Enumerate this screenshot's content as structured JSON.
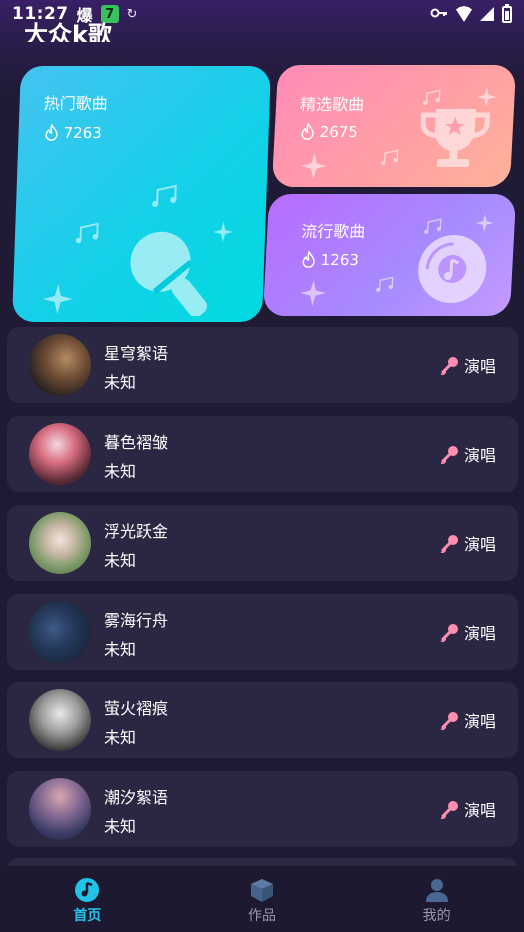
{
  "status_bar": {
    "time": "11:27",
    "app_icon": "爆",
    "badge": "7",
    "sync": "↻"
  },
  "app": {
    "title": "大众k歌"
  },
  "categories": [
    {
      "title": "热门歌曲",
      "count": "7263",
      "icon": "microphone-icon",
      "color": "#1fcde6"
    },
    {
      "title": "精选歌曲",
      "count": "2675",
      "icon": "trophy-icon",
      "color": "#ff9aaa"
    },
    {
      "title": "流行歌曲",
      "count": "1263",
      "icon": "disc-icon",
      "color": "#b07bff"
    }
  ],
  "songs": [
    {
      "name": "星穹絮语",
      "artist": "未知",
      "action": "演唱"
    },
    {
      "name": "暮色褶皱",
      "artist": "未知",
      "action": "演唱"
    },
    {
      "name": "浮光跃金",
      "artist": "未知",
      "action": "演唱"
    },
    {
      "name": "雾海行舟",
      "artist": "未知",
      "action": "演唱"
    },
    {
      "name": "萤火褶痕",
      "artist": "未知",
      "action": "演唱"
    },
    {
      "name": "潮汐絮语",
      "artist": "未知",
      "action": "演唱"
    }
  ],
  "nav": [
    {
      "label": "首页",
      "icon": "music-disc-icon",
      "active": true
    },
    {
      "label": "作品",
      "icon": "cube-icon",
      "active": false
    },
    {
      "label": "我的",
      "icon": "person-icon",
      "active": false
    }
  ],
  "colors": {
    "accent": "#22c3e6",
    "mic_pink": "#ff8fb0",
    "card_bg": "#2b2742"
  }
}
